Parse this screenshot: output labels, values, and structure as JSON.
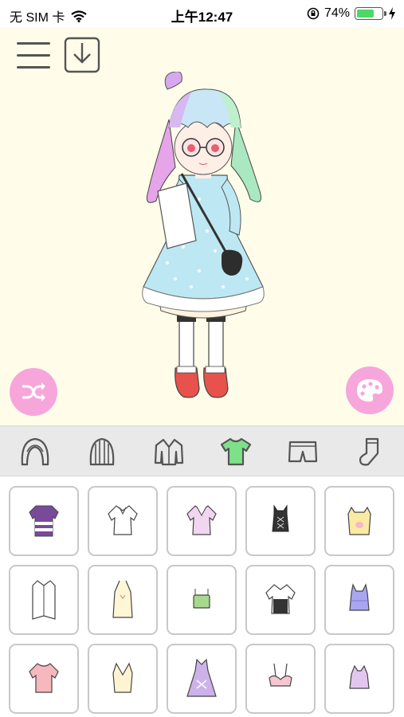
{
  "status_bar": {
    "carrier": "无 SIM 卡",
    "time": "上午12:47",
    "battery_percent": "74%",
    "battery_level": 0.74,
    "battery_color": "#4cd964"
  },
  "toolbar": {
    "menu_icon": "hamburger-menu-icon",
    "download_icon": "download-icon"
  },
  "stage": {
    "background": "#fffde9",
    "shuffle_icon": "shuffle-icon",
    "palette_icon": "palette-icon",
    "accent": "#f7a6dc"
  },
  "categories": [
    {
      "name": "hair",
      "icon": "hair-icon",
      "selected": false
    },
    {
      "name": "hat",
      "icon": "hat-icon",
      "selected": false
    },
    {
      "name": "jacket",
      "icon": "jacket-icon",
      "selected": false
    },
    {
      "name": "top",
      "icon": "tshirt-icon",
      "selected": true
    },
    {
      "name": "bottom",
      "icon": "shorts-icon",
      "selected": false
    },
    {
      "name": "socks",
      "icon": "sock-icon",
      "selected": false
    }
  ],
  "selected_color": "#7fe08a",
  "items": [
    {
      "icon": "striped-purple-tee-icon"
    },
    {
      "icon": "white-blouse-icon"
    },
    {
      "icon": "lavender-blouse-icon"
    },
    {
      "icon": "black-corset-top-icon"
    },
    {
      "icon": "yellow-bunny-cami-icon"
    },
    {
      "icon": "white-long-shirt-icon"
    },
    {
      "icon": "cream-halter-top-icon"
    },
    {
      "icon": "green-tube-top-icon"
    },
    {
      "icon": "black-white-corset-shirt-icon"
    },
    {
      "icon": "purple-gingham-cami-icon"
    },
    {
      "icon": "pink-tee-icon"
    },
    {
      "icon": "cream-halter-dress-top-icon"
    },
    {
      "icon": "lilac-dress-top-icon"
    },
    {
      "icon": "pink-bikini-top-icon"
    },
    {
      "icon": "lilac-crop-top-icon"
    }
  ]
}
